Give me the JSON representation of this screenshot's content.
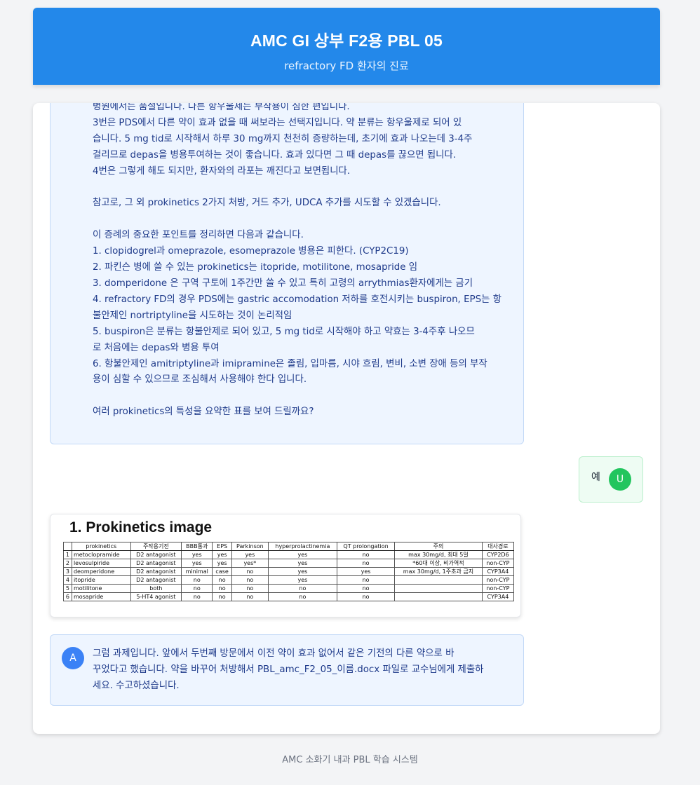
{
  "header": {
    "title": "AMC GI 상부 F2용 PBL 05",
    "subtitle": "refractory FD 환자의 진료"
  },
  "messages": [
    {
      "role": "assistant",
      "text": "병원에서는 품절입니다. 다른 항우울제는 부작용이 심한 편입니다.\n3번은 PDS에서 다른 약이 효과 없을 때 써보라는 선택지입니다. 약 분류는 항우울제로 되어 있\n습니다. 5 mg tid로 시작해서 하루 30 mg까지 천천히 증량하는데, 초기에 효과 나오는데 3-4주\n걸리므로 depas을 병용투여하는 것이 좋습니다. 효과 있다면 그 때 depas를 끊으면 됩니다.\n4번은 그렇게 해도 되지만, 환자와의 라포는 깨진다고 보면됩니다.\n\n참고로, 그 외 prokinetics 2가지 처방, 거드 추가, UDCA 추가를 시도할 수 있겠습니다.\n\n이 증례의 중요한 포인트를 정리하면 다음과 같습니다.\n1. clopidogrel과 omeprazole, esomeprazole 병용은 피한다. (CYP2C19)\n2. 파킨슨 병에 쓸 수 있는 prokinetics는 itopride, motilitone, mosapride 임\n3. domperidone 은 구역 구토에 1주간만 쓸 수 있고 특히 고령의 arrythmias환자에게는 금기\n4. refractory FD의 경우 PDS에는 gastric accomodation 저하를 호전시키는 buspiron, EPS는 항\n불안제인 nortriptyline을 시도하는 것이 논리적임\n5. buspiron은 분류는 항불안제로 되어 있고, 5 mg tid로 시작해야 하고 약효는 3-4주후 나오므\n로 처음에는 depas와 병용 투여\n6. 항불안제인 amitriptyline과 imipramine은 졸림, 입마름, 시야 흐림, 변비, 소변 장애 등의 부작\n용이 심할 수 있으므로 조심해서 사용해야 한다 입니다.\n\n여러 prokinetics의 특성을 요약한 표를 보여 드릴까요?"
    },
    {
      "role": "user",
      "text": "예",
      "avatar": "U"
    },
    {
      "role": "assistant",
      "avatar": "A",
      "text": "그럼 과제입니다. 앞에서 두번째 방문에서 이전 약이 효과 없어서 같은 기전의 다른 약으로 바\n꾸었다고 했습니다. 약을 바꾸어 처방해서 PBL_amc_F2_05_이름.docx 파일로 교수님에게 제출하\n세요. 수고하셨습니다."
    }
  ],
  "image": {
    "title": "1. Prokinetics image",
    "table": {
      "headers": [
        "",
        "prokinetics",
        "주작용기전",
        "BBB통과",
        "EPS",
        "Parkinson",
        "hyperprolactinemia",
        "QT prolongation",
        "주의",
        "대사경로"
      ],
      "rows": [
        [
          "1",
          "metoclopramide",
          "D2 antagonist",
          "yes",
          "yes",
          "yes",
          "yes",
          "no",
          "max 30mg/d, 최대 5일",
          "CYP2D6"
        ],
        [
          "2",
          "levosulpiride",
          "D2 antagonist",
          "yes",
          "yes",
          "yes*",
          "yes",
          "no",
          "*60대 이상, 비가역적",
          "non-CYP"
        ],
        [
          "3",
          "deomperidone",
          "D2 antagonist",
          "minimal",
          "case",
          "no",
          "yes",
          "yes",
          "max 30mg/d, 1주초과 금지",
          "CYP3A4"
        ],
        [
          "4",
          "itopride",
          "D2 antagonist",
          "no",
          "no",
          "no",
          "yes",
          "no",
          "",
          "non-CYP"
        ],
        [
          "5",
          "motilitone",
          "both",
          "no",
          "no",
          "no",
          "no",
          "no",
          "",
          "non-CYP"
        ],
        [
          "6",
          "mosapride",
          "5-HT4 agonist",
          "no",
          "no",
          "no",
          "no",
          "no",
          "",
          "CYP3A4"
        ]
      ]
    }
  },
  "footer": {
    "text": "AMC 소화기 내과 PBL 학습 시스템"
  }
}
